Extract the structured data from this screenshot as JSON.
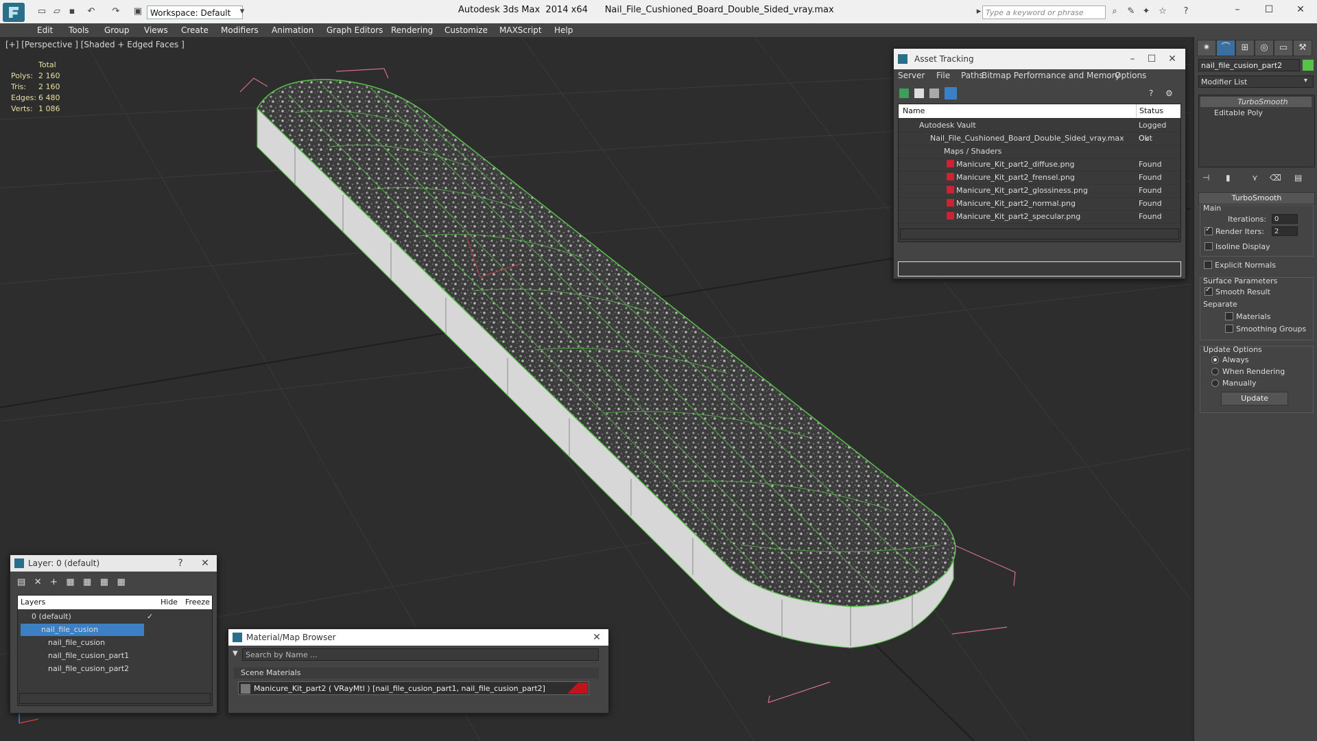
{
  "titlebar": {
    "workspace": "Workspace: Default",
    "app_name": "Autodesk 3ds Max  2014 x64",
    "file_name": "Nail_File_Cushioned_Board_Double_Sided_vray.max",
    "search_placeholder": "Type a keyword or phrase"
  },
  "menu": [
    "Edit",
    "Tools",
    "Group",
    "Views",
    "Create",
    "Modifiers",
    "Animation",
    "Graph Editors",
    "Rendering",
    "Customize",
    "MAXScript",
    "Help"
  ],
  "viewport": {
    "label": "[+] [Perspective ] [Shaded + Edged Faces ]",
    "stats": {
      "total_label": "Total",
      "polys_label": "Polys:",
      "polys": "2 160",
      "tris_label": "Tris:",
      "tris": "2 160",
      "edges_label": "Edges:",
      "edges": "6 480",
      "verts_label": "Verts:",
      "verts": "1 086"
    }
  },
  "asset_tracking": {
    "title": "Asset Tracking",
    "menu": [
      "Server",
      "File",
      "Paths",
      "Bitmap Performance and Memory",
      "Options"
    ],
    "col_name": "Name",
    "col_status": "Status",
    "rows": [
      {
        "name": "Autodesk Vault",
        "status": "Logged Out"
      },
      {
        "name": "Nail_File_Cushioned_Board_Double_Sided_vray.max",
        "status": "Ok"
      },
      {
        "name": "Maps / Shaders",
        "status": ""
      },
      {
        "name": "Manicure_Kit_part2_diffuse.png",
        "status": "Found"
      },
      {
        "name": "Manicure_Kit_part2_frensel.png",
        "status": "Found"
      },
      {
        "name": "Manicure_Kit_part2_glossiness.png",
        "status": "Found"
      },
      {
        "name": "Manicure_Kit_part2_normal.png",
        "status": "Found"
      },
      {
        "name": "Manicure_Kit_part2_specular.png",
        "status": "Found"
      }
    ]
  },
  "command_panel": {
    "object_name": "nail_file_cusion_part2",
    "object_color": "#58c14a",
    "modifier_list": "Modifier List",
    "stack": [
      "TurboSmooth",
      "Editable Poly"
    ],
    "turbosmooth": {
      "title": "TurboSmooth",
      "main": "Main",
      "iterations_label": "Iterations:",
      "iterations": "0",
      "render_iters_label": "Render Iters:",
      "render_iters": "2",
      "isoline": "Isoline Display",
      "explicit_normals": "Explicit Normals",
      "surface_params": "Surface Parameters",
      "smooth_result": "Smooth Result",
      "separate": "Separate",
      "materials": "Materials",
      "smoothing_groups": "Smoothing Groups",
      "update_options": "Update Options",
      "always": "Always",
      "when_rendering": "When Rendering",
      "manually": "Manually",
      "update_button": "Update"
    }
  },
  "layer_dialog": {
    "title": "Layer: 0 (default)",
    "col_layers": "Layers",
    "col_hide": "Hide",
    "col_freeze": "Freeze",
    "rows": [
      "0 (default)",
      "nail_file_cusion",
      "nail_file_cusion",
      "nail_file_cusion_part1",
      "nail_file_cusion_part2"
    ]
  },
  "material_browser": {
    "title": "Material/Map Browser",
    "search_placeholder": "Search by Name ...",
    "section": "Scene Materials",
    "item": "Manicure_Kit_part2  ( VRayMtl )  [nail_file_cusion_part1, nail_file_cusion_part2]"
  }
}
